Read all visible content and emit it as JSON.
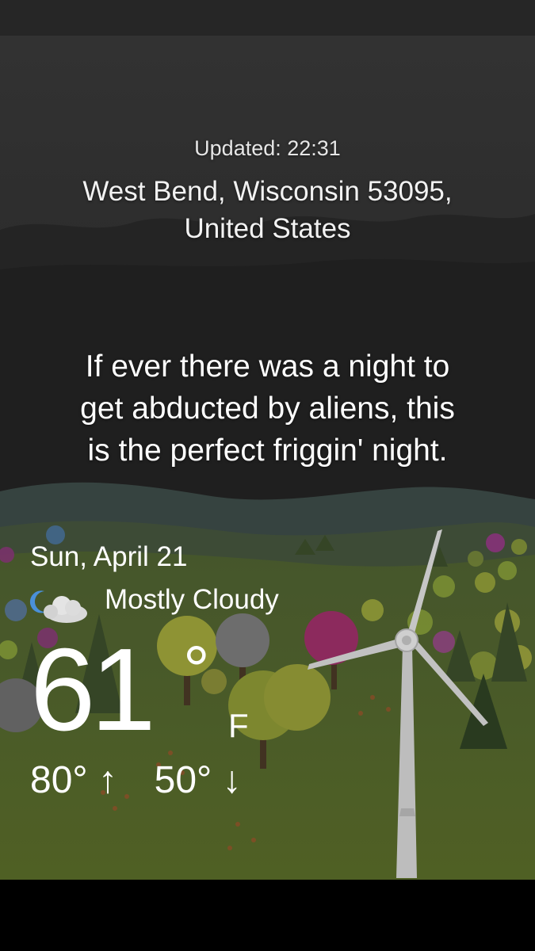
{
  "header": {
    "updated": "Updated: 22:31",
    "location_line1": "West Bend, Wisconsin 53095,",
    "location_line2": "United States"
  },
  "quote": {
    "line1": "If ever there was a night to",
    "line2": "get abducted by aliens, this",
    "line3": "is the perfect friggin' night."
  },
  "weather": {
    "date": "Sun, April 21",
    "condition": "Mostly Cloudy",
    "condition_icon": "moon-cloud-icon",
    "temperature": "61",
    "degree_symbol": "°",
    "unit": "F",
    "high": "80°",
    "high_arrow": "↑",
    "low": "50°",
    "low_arrow": "↓"
  },
  "colors": {
    "sky": "#2b2b2b",
    "hills": "#3a4a45",
    "meadow": "#56692e",
    "text": "#ffffff"
  }
}
